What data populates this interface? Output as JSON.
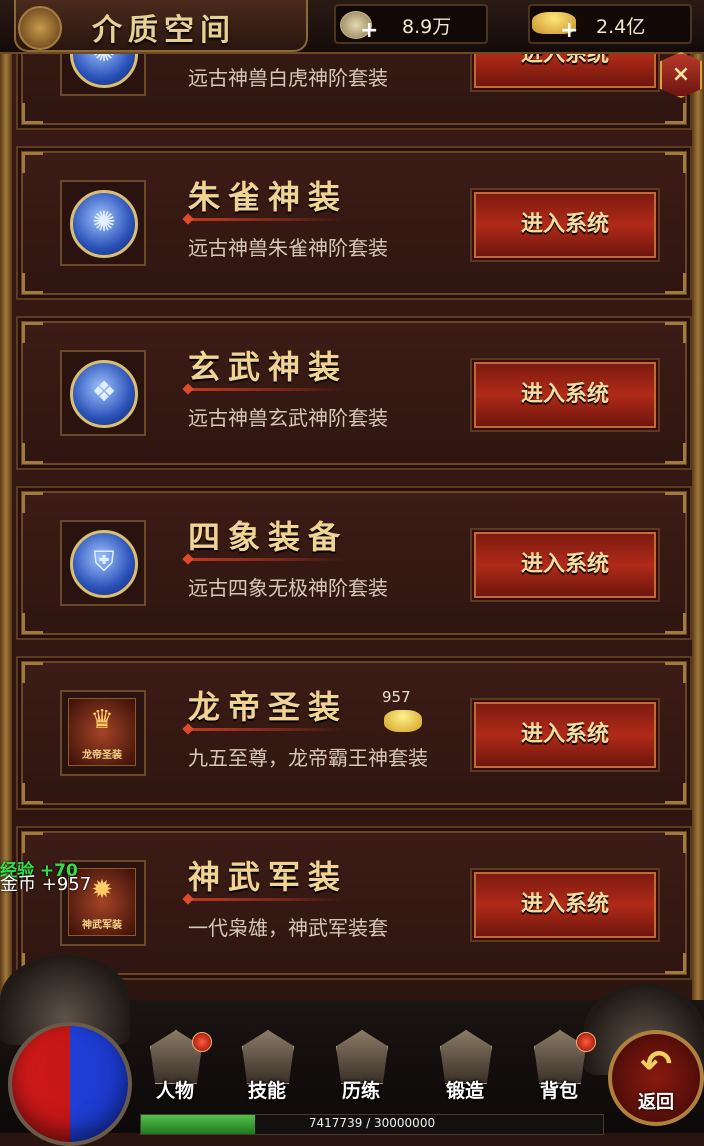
{
  "header": {
    "title": "介质空间",
    "coin_value": "8.9万",
    "ingot_value": "2.4亿",
    "plus_label": "+",
    "close_label": "×"
  },
  "rows": [
    {
      "title": "",
      "desc": "远古神兽白虎神阶套装",
      "button": "进入系统",
      "icon": "tiger-icon",
      "glyph": "✺"
    },
    {
      "title": "朱雀神装",
      "desc": "远古神兽朱雀神阶套装",
      "button": "进入系统",
      "icon": "phoenix-icon",
      "glyph": "✺"
    },
    {
      "title": "玄武神装",
      "desc": "远古神兽玄武神阶套装",
      "button": "进入系统",
      "icon": "tortoise-icon",
      "glyph": "❖"
    },
    {
      "title": "四象装备",
      "desc": "远古四象无极神阶套装",
      "button": "进入系统",
      "icon": "armor-icon",
      "glyph": "⛨"
    },
    {
      "title": "龙帝圣装",
      "desc": "九五至尊，龙帝霸王神套装",
      "button": "进入系统",
      "icon": "dragon-emperor-icon",
      "glyph": "♛",
      "caption": "龙帝圣装",
      "badge": "957"
    },
    {
      "title": "神武军装",
      "desc": "一代枭雄，神武军装套",
      "button": "进入系统",
      "icon": "war-armor-icon",
      "glyph": "✹",
      "caption": "神武军装"
    }
  ],
  "floating": {
    "xp": "经验 +70",
    "gold_label": "金币",
    "gold_value": "+957"
  },
  "nav": [
    {
      "label": "人物",
      "icon": "character-icon",
      "dot": true
    },
    {
      "label": "技能",
      "icon": "skills-book-icon",
      "dot": false
    },
    {
      "label": "历练",
      "icon": "training-icon",
      "dot": false
    },
    {
      "label": "锻造",
      "icon": "forge-anvil-icon",
      "dot": false
    },
    {
      "label": "背包",
      "icon": "backpack-icon",
      "dot": true
    }
  ],
  "back": {
    "label": "返回",
    "arrow": "↶"
  },
  "exp": {
    "text": "7417739 / 30000000",
    "fraction": 0.247
  },
  "colors": {
    "accent": "#b02a18",
    "gold": "#f1d493",
    "panel": "#3d1c16"
  }
}
